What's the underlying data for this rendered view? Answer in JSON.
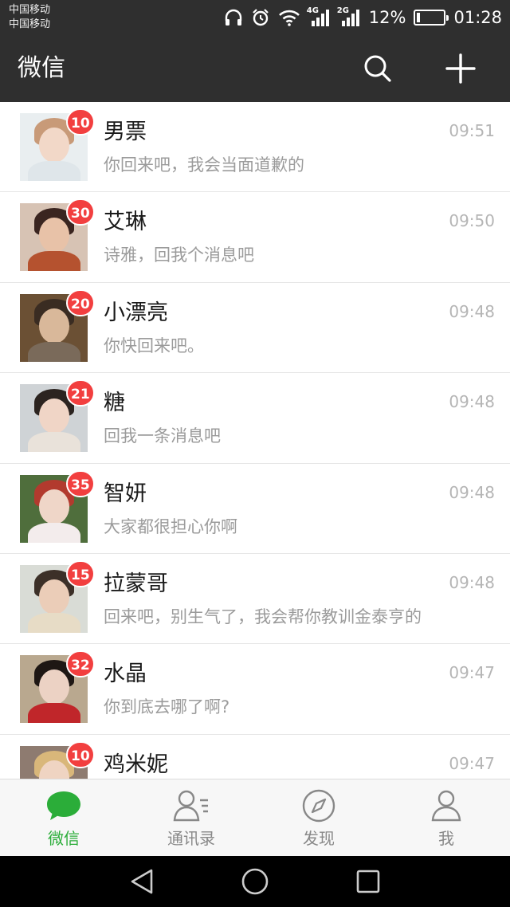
{
  "status_bar": {
    "carrier_1": "中国移动",
    "carrier_2": "中国移动",
    "sim1_tag": "4G",
    "sim2_tag": "2G",
    "battery_percent": "12%",
    "battery_level": 0.12,
    "time": "01:28",
    "icons": [
      "headphones-icon",
      "alarm-icon",
      "wifi-icon",
      "signal-icon",
      "battery-icon"
    ]
  },
  "app_bar": {
    "title": "微信",
    "icons": [
      "search-icon",
      "plus-icon"
    ]
  },
  "chats": [
    {
      "name": "男票",
      "preview": "你回来吧，我会当面道歉的",
      "time": "09:51",
      "badge": "10"
    },
    {
      "name": "艾琳",
      "preview": "诗雅，回我个消息吧",
      "time": "09:50",
      "badge": "30"
    },
    {
      "name": "小漂亮",
      "preview": "你快回来吧。",
      "time": "09:48",
      "badge": "20"
    },
    {
      "name": "糖",
      "preview": "回我一条消息吧",
      "time": "09:48",
      "badge": "21"
    },
    {
      "name": "智妍",
      "preview": "大家都很担心你啊",
      "time": "09:48",
      "badge": "35"
    },
    {
      "name": "拉蒙哥",
      "preview": "回来吧，别生气了，我会帮你教训金泰亨的",
      "time": "09:48",
      "badge": "15"
    },
    {
      "name": "水晶",
      "preview": "你到底去哪了啊?",
      "time": "09:47",
      "badge": "32"
    },
    {
      "name": "鸡米妮",
      "preview": "",
      "time": "09:47",
      "badge": "10"
    }
  ],
  "tabs": [
    {
      "label": "微信",
      "icon": "chat-bubble-icon",
      "active": true
    },
    {
      "label": "通讯录",
      "icon": "contacts-icon",
      "active": false
    },
    {
      "label": "发现",
      "icon": "compass-icon",
      "active": false
    },
    {
      "label": "我",
      "icon": "person-icon",
      "active": false
    }
  ],
  "nav_bar": {
    "icons": [
      "back-triangle-icon",
      "home-circle-icon",
      "recents-square-icon"
    ]
  },
  "colors": {
    "header_bg": "#2f2f2f",
    "badge_red": "#f23f3f",
    "active_green": "#2bad39",
    "inactive_gray": "#888888"
  }
}
